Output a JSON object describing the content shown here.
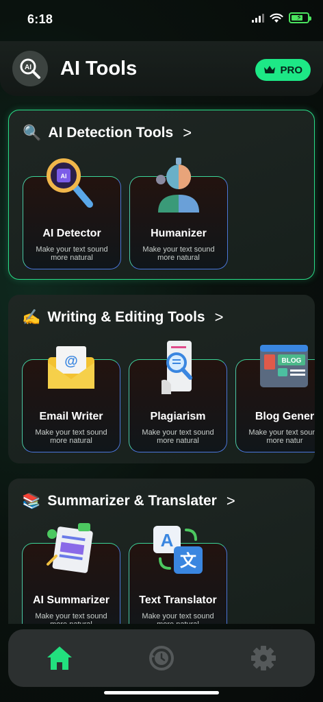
{
  "status_bar": {
    "time": "6:18"
  },
  "header": {
    "title": "AI Tools",
    "pro_label": "PRO"
  },
  "sections": [
    {
      "title": "AI Detection Tools",
      "emoji": "🔍",
      "tools": [
        {
          "title": "AI Detector",
          "desc": "Make your text sound more natural",
          "icon": "magnifier-chip-icon"
        },
        {
          "title": "Humanizer",
          "desc": "Make your text sound more natural",
          "icon": "robot-human-icon"
        }
      ]
    },
    {
      "title": "Writing & Editing Tools",
      "emoji": "✍️",
      "tools": [
        {
          "title": "Email Writer",
          "desc": "Make your text sound more natural",
          "icon": "email-envelope-icon"
        },
        {
          "title": "Plagiarism",
          "desc": "Make your text sound more natural",
          "icon": "document-search-icon"
        },
        {
          "title": "Blog Gener",
          "desc": "Make your text sound more natur",
          "icon": "blog-window-icon"
        }
      ]
    },
    {
      "title": "Summarizer & Translater",
      "emoji": "📚",
      "tools": [
        {
          "title": "AI Summarizer",
          "desc": "Make your text sound more natural",
          "icon": "summary-document-icon"
        },
        {
          "title": "Text Translator",
          "desc": "Make your text sound more natural",
          "icon": "translate-icon"
        }
      ]
    }
  ],
  "colors": {
    "accent": "#1de886",
    "home_active": "#22e07e",
    "nav_inactive": "#55595a"
  }
}
